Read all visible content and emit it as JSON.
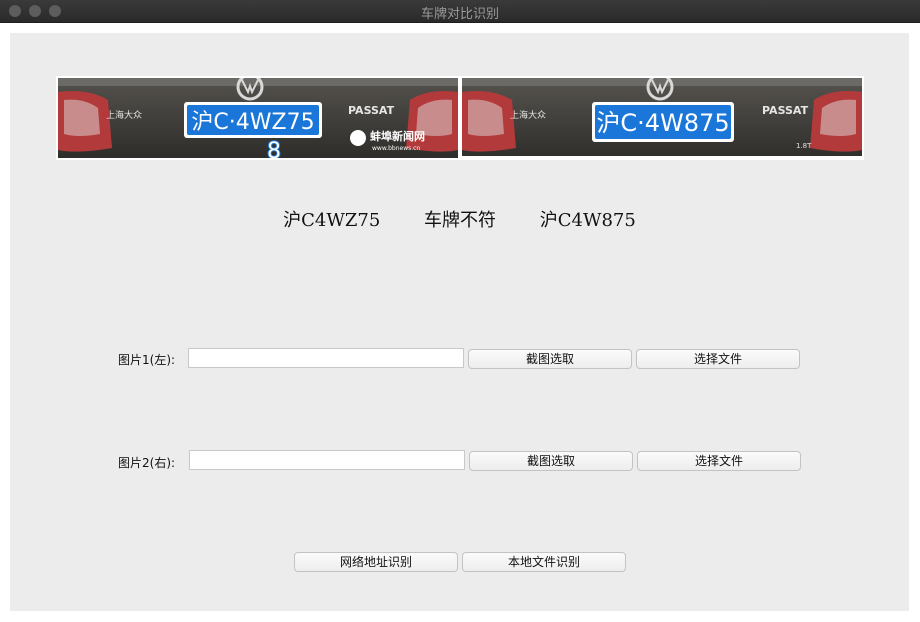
{
  "window": {
    "title": "车牌对比识别"
  },
  "images": {
    "left": {
      "plate_text": "沪C·4WZ75",
      "badge_text": "PASSAT",
      "maker_text": "上海大众",
      "watermark": "蚌埠新闻网",
      "watermark_url": "www.bbnews.cn",
      "overlay_char": "8"
    },
    "right": {
      "plate_text": "沪C·4W875",
      "badge_text": "PASSAT",
      "maker_text": "上海大众",
      "engine_badge": "1.8T"
    }
  },
  "results": {
    "left_plate": "沪C4WZ75",
    "compare_result": "车牌不符",
    "right_plate": "沪C4W875"
  },
  "row1": {
    "label": "图片1(左):",
    "input_value": "",
    "capture_button": "截图选取",
    "file_button": "选择文件"
  },
  "row2": {
    "label": "图片2(右):",
    "input_value": "",
    "capture_button": "截图选取",
    "file_button": "选择文件"
  },
  "actions": {
    "url_recognize": "网络地址识别",
    "local_recognize": "本地文件识别"
  }
}
